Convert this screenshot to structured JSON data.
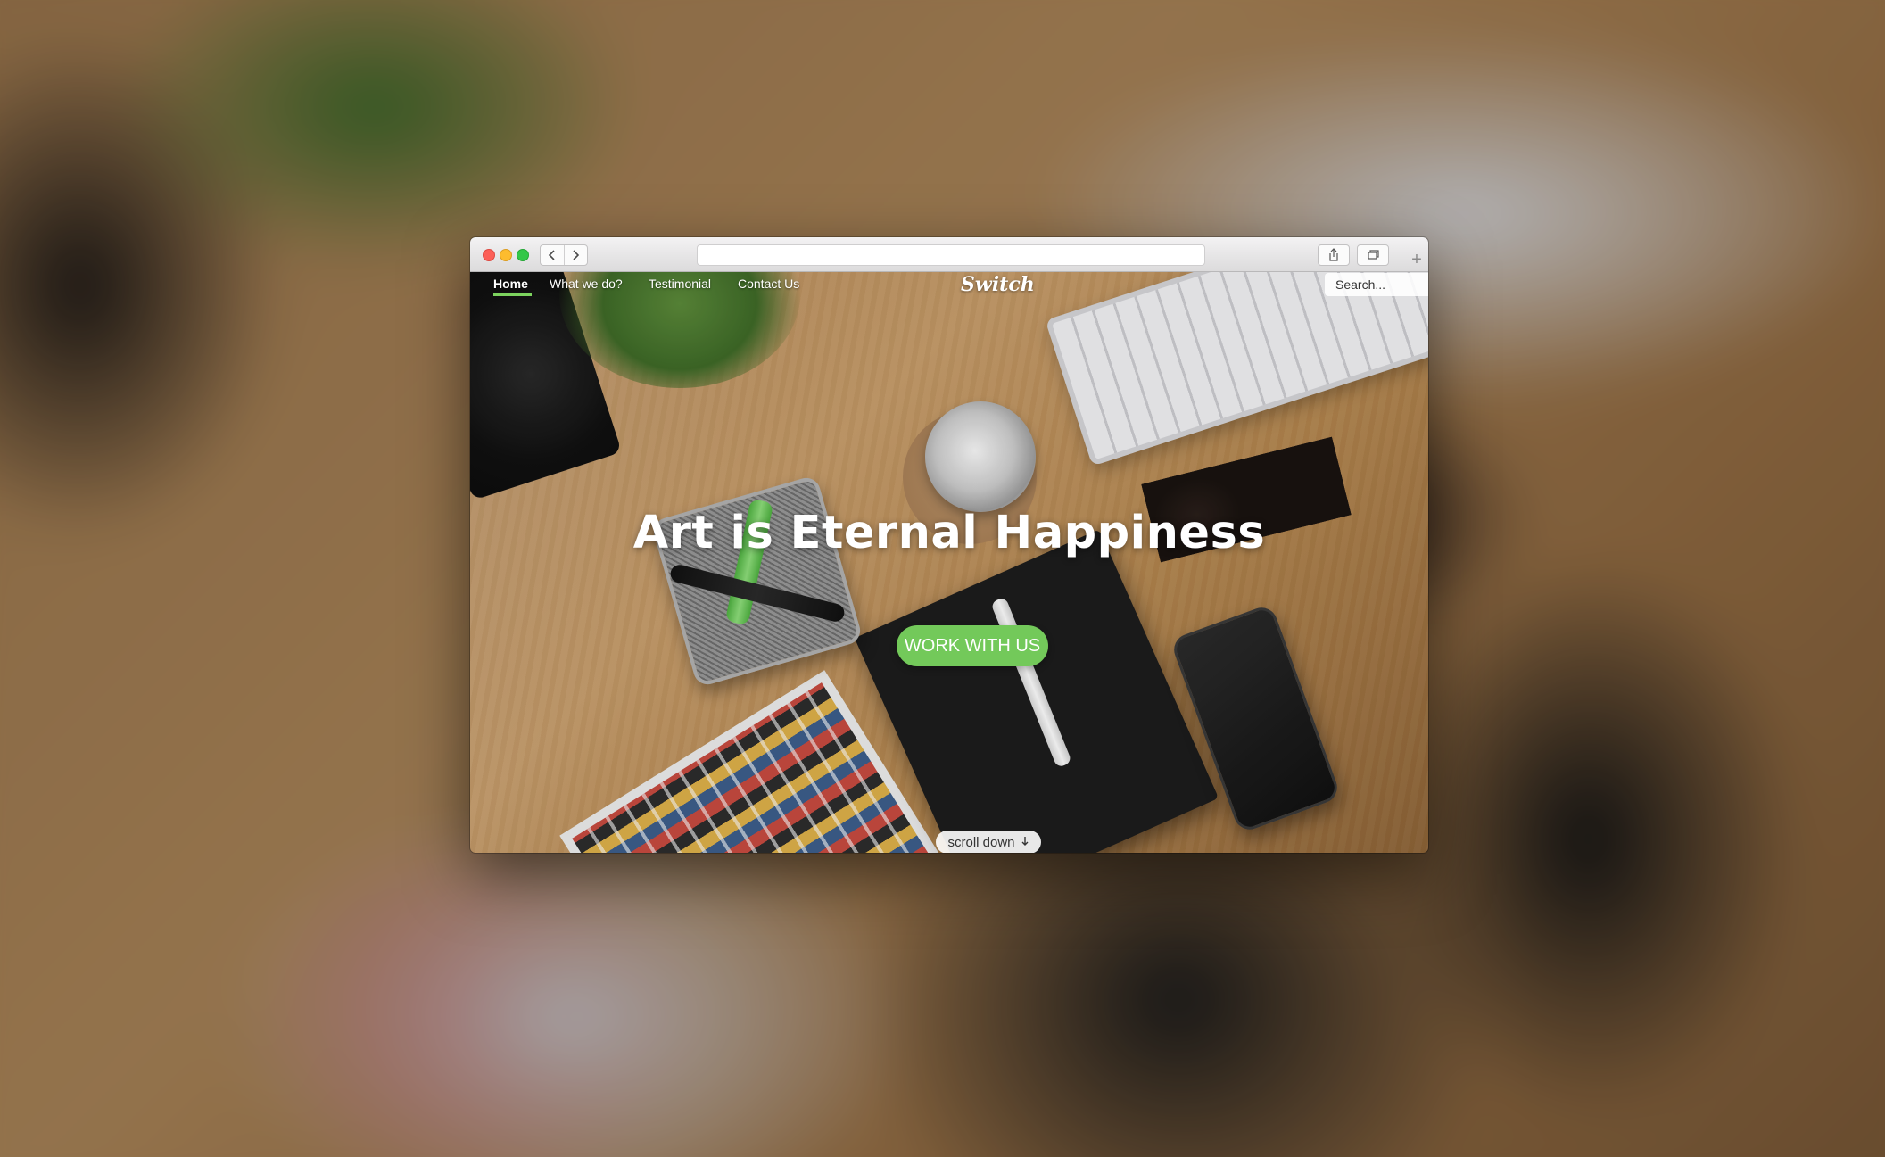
{
  "site": {
    "logo": "Switch",
    "nav": [
      {
        "label": "Home",
        "active": true
      },
      {
        "label": "What we do?"
      },
      {
        "label": "Testimonial"
      },
      {
        "label": "Contact Us"
      }
    ],
    "search_placeholder": "Search..."
  },
  "hero": {
    "headline": "Art is Eternal Happiness",
    "cta_label": "WORK WITH US",
    "scroll_label": "scroll down",
    "scroll_icon": "arrow-down-icon"
  },
  "browser": {
    "nav_back_icon": "chevron-left-icon",
    "nav_forward_icon": "chevron-right-icon",
    "share_icon": "share-icon",
    "tabs_icon": "tabs-overview-icon",
    "new_tab_icon": "plus-icon"
  },
  "colors": {
    "accent": "#73c95a",
    "nav_underline": "#7cd35e"
  }
}
